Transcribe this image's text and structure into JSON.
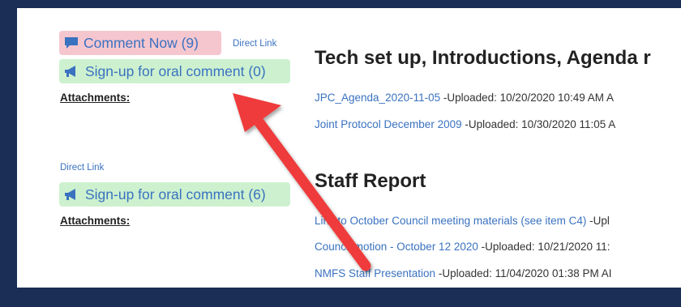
{
  "items": [
    {
      "comment_now_label": "Comment Now (9)",
      "direct_link": "Direct Link",
      "signup_label": "Sign-up for oral comment (0)",
      "attachments_label": "Attachments:",
      "title": "Tech set up, Introductions, Agenda r",
      "files": [
        {
          "name": "JPC_Agenda_2020-11-05",
          "meta": " -Uploaded: 10/20/2020 10:49 AM A"
        },
        {
          "name": "Joint Protocol December 2009",
          "meta": " -Uploaded: 10/30/2020 11:05 A"
        }
      ]
    },
    {
      "direct_link": "Direct Link",
      "signup_label": "Sign-up for oral comment (6)",
      "attachments_label": "Attachments:",
      "title": "Staff Report",
      "files": [
        {
          "name": "Link to October Council meeting materials (see item C4)",
          "meta": " -Upl"
        },
        {
          "name": "Council motion - October 12 2020",
          "meta": " -Uploaded: 10/21/2020 11:"
        },
        {
          "name": "NMFS Staff Presentation",
          "meta": " -Uploaded: 11/04/2020 01:38 PM AI"
        }
      ]
    }
  ],
  "icons": {
    "comment": "comment-icon",
    "megaphone": "megaphone-icon"
  },
  "colors": {
    "frame": "#1b2e55",
    "link": "#3a72c0",
    "comment_bg": "#f6c6cf",
    "signup_bg": "#cdf1cf",
    "arrow": "#ef3b3b"
  }
}
